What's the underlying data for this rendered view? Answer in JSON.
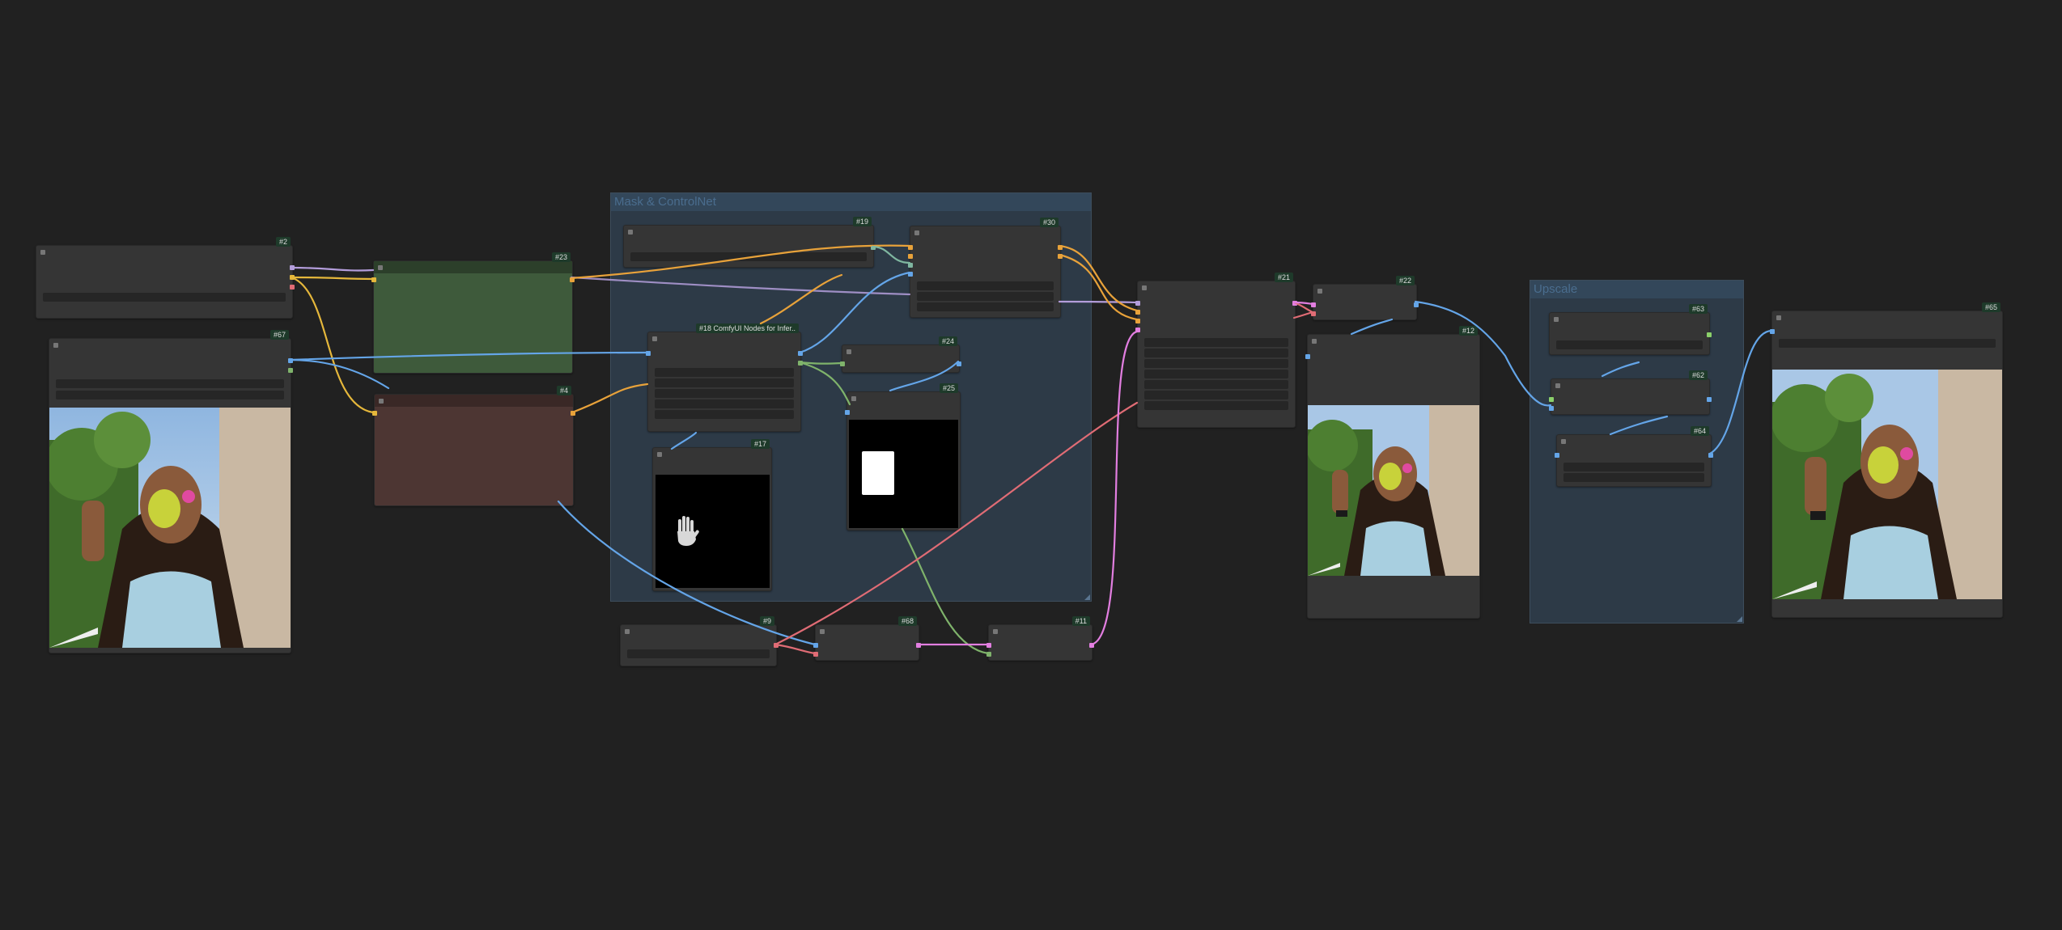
{
  "groups": {
    "mask_controlnet": {
      "title": "Mask & ControlNet"
    },
    "upscale": {
      "title": "Upscale"
    }
  },
  "nodes": {
    "n2": {
      "badge": "#2"
    },
    "n67": {
      "badge": "#67"
    },
    "n23": {
      "badge": "#23"
    },
    "n4": {
      "badge": "#4"
    },
    "n19": {
      "badge": "#19"
    },
    "n30": {
      "badge": "#30"
    },
    "n18": {
      "badge": "#18 ComfyUI Nodes for Infer.."
    },
    "n24": {
      "badge": "#24"
    },
    "n25": {
      "badge": "#25"
    },
    "n17": {
      "badge": "#17"
    },
    "n9": {
      "badge": "#9"
    },
    "n68": {
      "badge": "#68"
    },
    "n11": {
      "badge": "#11"
    },
    "n21": {
      "badge": "#21"
    },
    "n22": {
      "badge": "#22"
    },
    "n12": {
      "badge": "#12"
    },
    "n63": {
      "badge": "#63"
    },
    "n62": {
      "badge": "#62"
    },
    "n64": {
      "badge": "#64"
    },
    "n65": {
      "badge": "#65"
    }
  },
  "icons": {
    "hand": "hand-icon"
  },
  "colors": {
    "background": "#212121",
    "node": "#353535",
    "widget": "#262626",
    "group_fill": "#2d3a47",
    "positive_prompt_node": "#3e5a3b",
    "negative_prompt_node": "#4d3633",
    "wire_model": "#b39ddb",
    "wire_clip": "#e5b73b",
    "wire_image": "#64a5e8",
    "wire_mask": "#7fb36b",
    "wire_vae": "#e06c75",
    "wire_latent": "#e27ee0",
    "wire_conditioning": "#e8a23a"
  }
}
